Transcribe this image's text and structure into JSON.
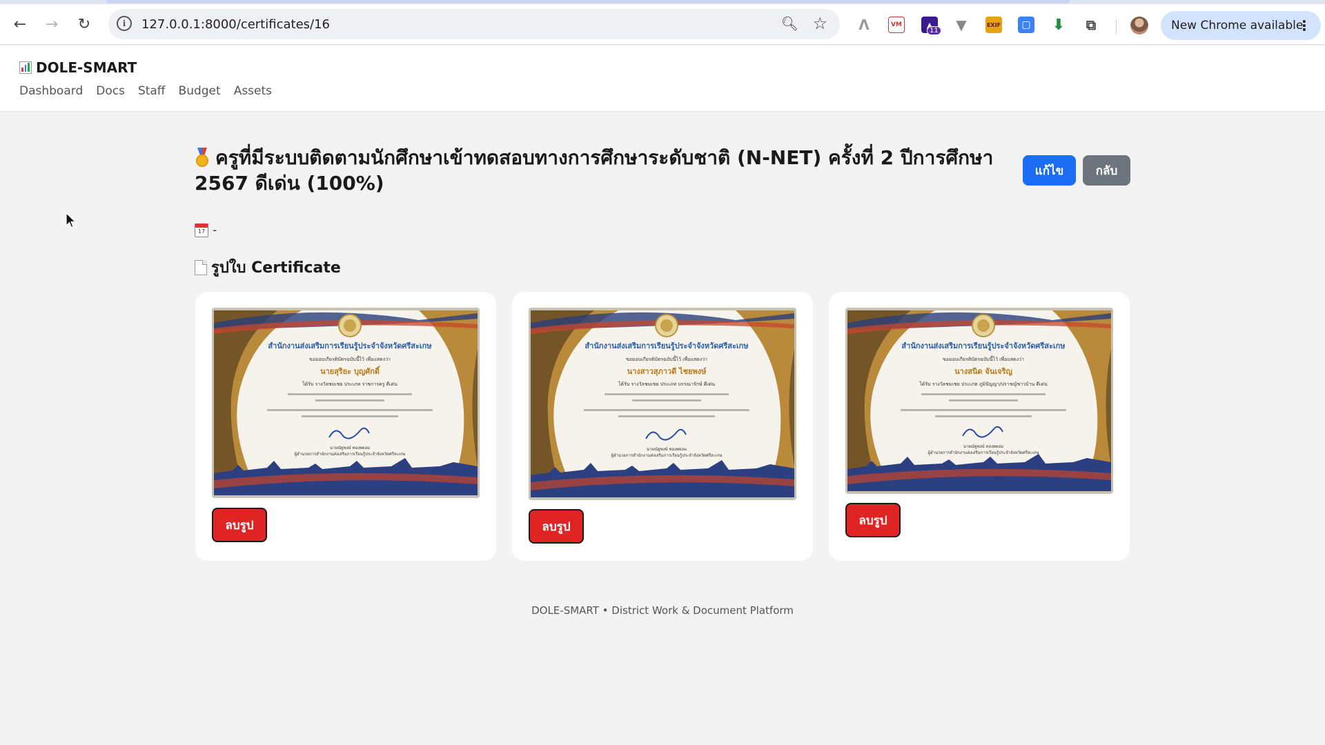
{
  "browser": {
    "url": "127.0.0.1:8000/certificates/16",
    "update_label": "New Chrome available",
    "extensions": [
      {
        "name": "vm-extension-icon",
        "text": "VM"
      },
      {
        "name": "exif-extension-icon",
        "text": "EXIF"
      }
    ],
    "badge_count": "11"
  },
  "app": {
    "brand": "DOLE-SMART",
    "nav": [
      "Dashboard",
      "Docs",
      "Staff",
      "Budget",
      "Assets"
    ]
  },
  "page": {
    "title": "ครูที่มีระบบติดตามนักศึกษาเข้าทดสอบทางการศึกษาระดับชาติ (N-NET) ครั้งที่ 2 ปีการศึกษา 2567 ดีเด่น (100%)",
    "edit_label": "แก้ไข",
    "back_label": "กลับ",
    "date_value": "-",
    "section_title": "รูปใบ Certificate"
  },
  "certificates": [
    {
      "office": "สำนักงานส่งเสริมการเรียนรู้ประจำจังหวัดศรีสะเกษ",
      "intro": "ขอมอบเกียรติบัตรฉบับนี้ไว้ เพื่อแสดงว่า",
      "name": "นายสุริยะ บุญศักดิ์",
      "award": "ได้รับ รางวัลชมเชย ประเภท ราชการครู ดีเด่น",
      "signer": "นายณัฐพงษ์ ทองพยอม",
      "signer_title": "ผู้อำนวยการสำนักงานส่งเสริมการเรียนรู้ประจำจังหวัดศรีสะเกษ",
      "delete_label": "ลบรูป"
    },
    {
      "office": "สำนักงานส่งเสริมการเรียนรู้ประจำจังหวัดศรีสะเกษ",
      "intro": "ขอมอบเกียรติบัตรฉบับนี้ไว้ เพื่อแสดงว่า",
      "name": "นางสาวสุภาวดี ไชยพงษ์",
      "award": "ได้รับ รางวัลชมเชย ประเภท บรรณารักษ์ ดีเด่น",
      "signer": "นายณัฐพงษ์ ทองพยอม",
      "signer_title": "ผู้อำนวยการสำนักงานส่งเสริมการเรียนรู้ประจำจังหวัดศรีสะเกษ",
      "delete_label": "ลบรูป"
    },
    {
      "office": "สำนักงานส่งเสริมการเรียนรู้ประจำจังหวัดศรีสะเกษ",
      "intro": "ขอมอบเกียรติบัตรฉบับนี้ไว้ เพื่อแสดงว่า",
      "name": "นางสนิด จันเจริญ",
      "award": "ได้รับ รางวัลชมเชย ประเภท ภูมิปัญญา/ปราชญ์ชาวบ้าน ดีเด่น",
      "signer": "นายณัฐพงษ์ ทองพยอม",
      "signer_title": "ผู้อำนวยการสำนักงานส่งเสริมการเรียนรู้ประจำจังหวัดศรีสะเกษ",
      "delete_label": "ลบรูป"
    }
  ],
  "footer": "DOLE-SMART • District Work & Document Platform",
  "colors": {
    "primary": "#1b6ef3",
    "secondary": "#6c757d",
    "danger": "#e02424"
  }
}
